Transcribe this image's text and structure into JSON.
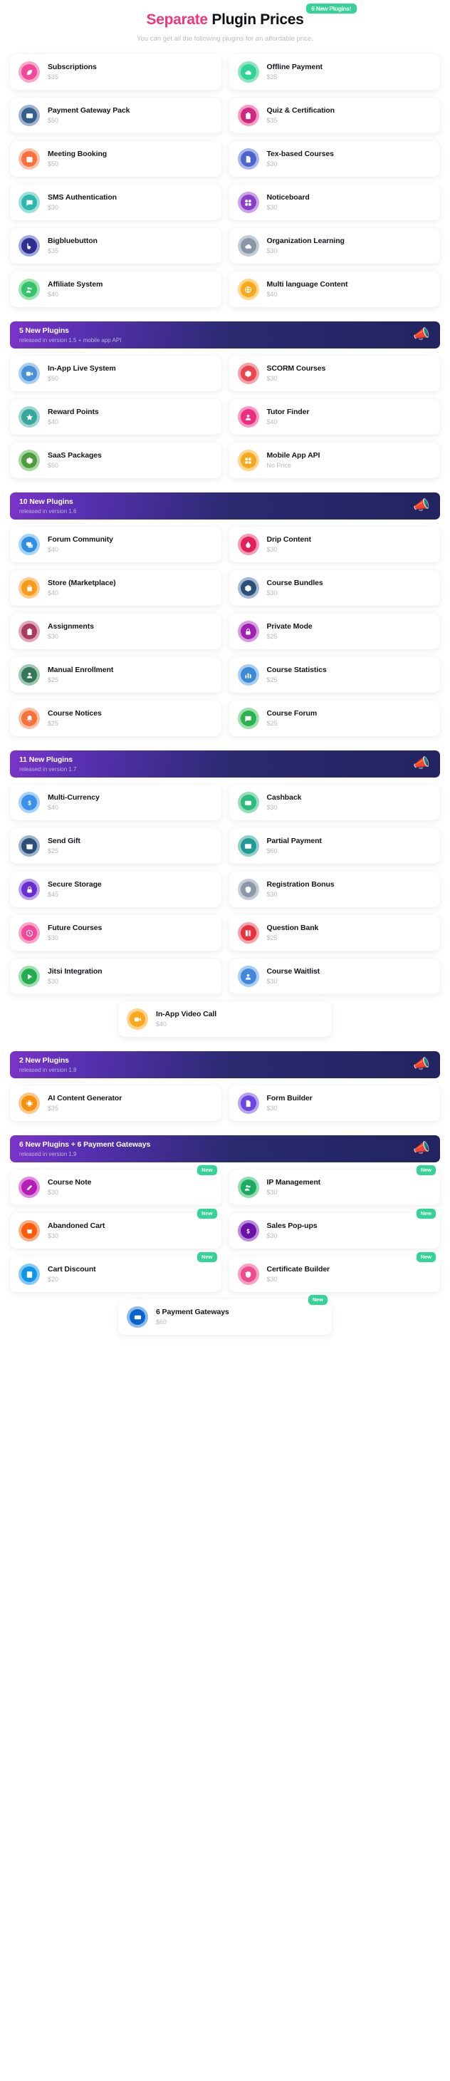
{
  "header": {
    "title_accent": "Separate",
    "title_rest": "Plugin Prices",
    "badge": "6 New Plugins!",
    "subtitle": "You can get all the following plugins for an affordable price."
  },
  "colors": {
    "accent_pink": "#f0367c",
    "badge_green": "#34d396",
    "bar_gradient_start": "#7b34c9",
    "bar_gradient_end": "#22245f",
    "price_gray": "#b6b9c1"
  },
  "sections": [
    {
      "id": "base-plugins",
      "bar": null,
      "layout": "two-column",
      "cards": [
        {
          "title": "Subscriptions",
          "price": "$35",
          "icon": "subscriptions-icon",
          "ring": "#f7a9c7",
          "core": "#f2479a",
          "badge": null
        },
        {
          "title": "Offline Payment",
          "price": "$35",
          "icon": "offline-payment-icon",
          "ring": "#8fe3c0",
          "core": "#2fd39a",
          "badge": null
        },
        {
          "title": "Payment Gateway Pack",
          "price": "$50",
          "icon": "payment-gateway-icon",
          "ring": "#9fb3cc",
          "core": "#33608f",
          "badge": null
        },
        {
          "title": "Quiz & Certification",
          "price": "$35",
          "icon": "quiz-certification-icon",
          "ring": "#f49bc2",
          "core": "#d0287e",
          "badge": null
        },
        {
          "title": "Meeting Booking",
          "price": "$50",
          "icon": "meeting-booking-icon",
          "ring": "#fbc0a8",
          "core": "#f96f3e",
          "badge": null
        },
        {
          "title": "Tex-based Courses",
          "price": "$30",
          "icon": "text-courses-icon",
          "ring": "#aab6e8",
          "core": "#4e63cf",
          "badge": null
        },
        {
          "title": "SMS Authentication",
          "price": "$30",
          "icon": "sms-authentication-icon",
          "ring": "#9adfd8",
          "core": "#2fb6ae",
          "badge": null
        },
        {
          "title": "Noticeboard",
          "price": "$30",
          "icon": "noticeboard-icon",
          "ring": "#c9a4e8",
          "core": "#8b3fc9",
          "badge": null
        },
        {
          "title": "Bigbluebutton",
          "price": "$35",
          "icon": "bigbluebutton-icon",
          "ring": "#a0a8e0",
          "core": "#2f2f8f",
          "badge": null
        },
        {
          "title": "Organization Learning",
          "price": "$30",
          "icon": "organization-learning-icon",
          "ring": "#c3cbd6",
          "core": "#8a96a6",
          "badge": null
        },
        {
          "title": "Affiliate System",
          "price": "$40",
          "icon": "affiliate-system-icon",
          "ring": "#9fe3b3",
          "core": "#34c46c",
          "badge": null
        },
        {
          "title": "Multi language Content",
          "price": "$40",
          "icon": "multi-language-icon",
          "ring": "#ffd68a",
          "core": "#f8a81c",
          "badge": null
        }
      ]
    },
    {
      "id": "v15-plugins",
      "bar": {
        "title": "5 New Plugins",
        "subtitle": "released in version 1.5 + mobile app API",
        "icon": "megaphone-icon"
      },
      "layout": "two-column",
      "cards": [
        {
          "title": "In-App Live System",
          "price": "$50",
          "icon": "in-app-live-icon",
          "ring": "#a9cdf2",
          "core": "#4a90d9",
          "badge": null
        },
        {
          "title": "SCORM Courses",
          "price": "$30",
          "icon": "scorm-courses-icon",
          "ring": "#f5a3aa",
          "core": "#e8454f",
          "badge": null
        },
        {
          "title": "Reward Points",
          "price": "$40",
          "icon": "reward-points-icon",
          "ring": "#9bd6cf",
          "core": "#3aa79c",
          "badge": null
        },
        {
          "title": "Tutor Finder",
          "price": "$40",
          "icon": "tutor-finder-icon",
          "ring": "#f79ac3",
          "core": "#ef2d7e",
          "badge": null
        },
        {
          "title": "SaaS Packages",
          "price": "$50",
          "icon": "saas-packages-icon",
          "ring": "#a8d6a0",
          "core": "#4e9c3e",
          "badge": null
        },
        {
          "title": "Mobile App API",
          "price": "No Price",
          "icon": "mobile-app-api-icon",
          "ring": "#ffd48b",
          "core": "#f7a81d",
          "badge": null
        }
      ]
    },
    {
      "id": "v16-plugins",
      "bar": {
        "title": "10 New Plugins",
        "subtitle": "released in version 1.6",
        "icon": "megaphone-icon"
      },
      "layout": "two-column",
      "cards": [
        {
          "title": "Forum Community",
          "price": "$40",
          "icon": "forum-community-icon",
          "ring": "#a6d3f7",
          "core": "#2f8fe8",
          "badge": null
        },
        {
          "title": "Drip Content",
          "price": "$30",
          "icon": "drip-content-icon",
          "ring": "#f69ab0",
          "core": "#e31e5a",
          "badge": null
        },
        {
          "title": "Store (Marketplace)",
          "price": "$40",
          "icon": "store-marketplace-icon",
          "ring": "#ffcb8e",
          "core": "#f99a18",
          "badge": null
        },
        {
          "title": "Course Bundles",
          "price": "$30",
          "icon": "course-bundles-icon",
          "ring": "#a5b8d1",
          "core": "#2c4f79",
          "badge": null
        },
        {
          "title": "Assignments",
          "price": "$30",
          "icon": "assignments-icon",
          "ring": "#e0a6ba",
          "core": "#a83b5e",
          "badge": null
        },
        {
          "title": "Private Mode",
          "price": "$25",
          "icon": "private-mode-icon",
          "ring": "#d79ce0",
          "core": "#a020b0",
          "badge": null
        },
        {
          "title": "Manual Enrollment",
          "price": "$25",
          "icon": "manual-enrollment-icon",
          "ring": "#9ec8b1",
          "core": "#33785a",
          "badge": null
        },
        {
          "title": "Course Statistics",
          "price": "$25",
          "icon": "course-statistics-icon",
          "ring": "#a7cdf3",
          "core": "#3d8ad4",
          "badge": null
        },
        {
          "title": "Course Notices",
          "price": "$25",
          "icon": "course-notices-icon",
          "ring": "#fbbda4",
          "core": "#f7713b",
          "badge": null
        },
        {
          "title": "Course Forum",
          "price": "$25",
          "icon": "course-forum-icon",
          "ring": "#9ddfac",
          "core": "#2bb14f",
          "badge": null
        }
      ]
    },
    {
      "id": "v17-plugins",
      "bar": {
        "title": "11 New Plugins",
        "subtitle": "released in version 1.7",
        "icon": "megaphone-icon"
      },
      "layout": "two-column-plus-center",
      "cards": [
        {
          "title": "Multi-Currency",
          "price": "$40",
          "icon": "multi-currency-icon",
          "ring": "#a8d1f8",
          "core": "#3b92ec",
          "badge": null
        },
        {
          "title": "Cashback",
          "price": "$30",
          "icon": "cashback-icon",
          "ring": "#98ddb9",
          "core": "#2bbd7c",
          "badge": null
        },
        {
          "title": "Send Gift",
          "price": "$25",
          "icon": "send-gift-icon",
          "ring": "#9fb3cd",
          "core": "#2c4e77",
          "badge": null
        },
        {
          "title": "Partial Payment",
          "price": "$60",
          "icon": "partial-payment-icon",
          "ring": "#93cfc9",
          "core": "#1f9a95",
          "badge": null
        },
        {
          "title": "Secure Storage",
          "price": "$45",
          "icon": "secure-storage-icon",
          "ring": "#bda0ea",
          "core": "#6b2fd1",
          "badge": null
        },
        {
          "title": "Registration Bonus",
          "price": "$30",
          "icon": "registration-bonus-icon",
          "ring": "#c4ccd6",
          "core": "#8c98a7",
          "badge": null
        },
        {
          "title": "Future Courses",
          "price": "$30",
          "icon": "future-courses-icon",
          "ring": "#f9a6c5",
          "core": "#f3479b",
          "badge": null
        },
        {
          "title": "Question Bank",
          "price": "$25",
          "icon": "question-bank-icon",
          "ring": "#f5a2a8",
          "core": "#e5323f",
          "badge": null
        },
        {
          "title": "Jitsi Integration",
          "price": "$30",
          "icon": "jitsi-integration-icon",
          "ring": "#9cdfb0",
          "core": "#22ad4e",
          "badge": null
        },
        {
          "title": "Course Waitlist",
          "price": "$30",
          "icon": "course-waitlist-icon",
          "ring": "#a9ccf5",
          "core": "#4287dc",
          "badge": null
        }
      ],
      "center_cards": [
        {
          "title": "In-App Video Call",
          "price": "$40",
          "icon": "in-app-video-call-icon",
          "ring": "#ffd38d",
          "core": "#f9a81b",
          "badge": null
        }
      ]
    },
    {
      "id": "v18-plugins",
      "bar": {
        "title": "2 New Plugins",
        "subtitle": "released in version 1.8",
        "icon": "megaphone-icon"
      },
      "layout": "two-column",
      "cards": [
        {
          "title": "AI Content Generator",
          "price": "$35",
          "icon": "ai-content-generator-icon",
          "ring": "#fbc98b",
          "core": "#f7900e",
          "badge": null
        },
        {
          "title": "Form Builder",
          "price": "$30",
          "icon": "form-builder-icon",
          "ring": "#b9a4f0",
          "core": "#6c46e0",
          "badge": null
        }
      ]
    },
    {
      "id": "v19-plugins",
      "bar": {
        "title": "6 New Plugins + 6 Payment Gateways",
        "subtitle": "released in version 1.9",
        "icon": "megaphone-icon"
      },
      "layout": "two-column-plus-center",
      "cards": [
        {
          "title": "Course Note",
          "price": "$30",
          "icon": "course-note-icon",
          "ring": "#de8ae0",
          "core": "#b51cb8",
          "badge": "New"
        },
        {
          "title": "IP Management",
          "price": "$30",
          "icon": "ip-management-icon",
          "ring": "#8fdcae",
          "core": "#1faa64",
          "badge": "New"
        },
        {
          "title": "Abandoned Cart",
          "price": "$30",
          "icon": "abandoned-cart-icon",
          "ring": "#fcae84",
          "core": "#fb5c0a",
          "badge": "New"
        },
        {
          "title": "Sales Pop-ups",
          "price": "$30",
          "icon": "sales-popups-icon",
          "ring": "#b98ade",
          "core": "#6a12a8",
          "badge": "New"
        },
        {
          "title": "Cart Discount",
          "price": "$20",
          "icon": "cart-discount-icon",
          "ring": "#86c8f5",
          "core": "#0f95ea",
          "badge": "New"
        },
        {
          "title": "Certificate Builder",
          "price": "$30",
          "icon": "certificate-builder-icon",
          "ring": "#f6a0c2",
          "core": "#ef4b8e",
          "badge": "New"
        }
      ],
      "center_cards": [
        {
          "title": "6 Payment Gateways",
          "price": "$60",
          "icon": "payment-gateways-icon",
          "ring": "#8bbbea",
          "core": "#0a62cf",
          "badge": "New"
        }
      ]
    }
  ]
}
